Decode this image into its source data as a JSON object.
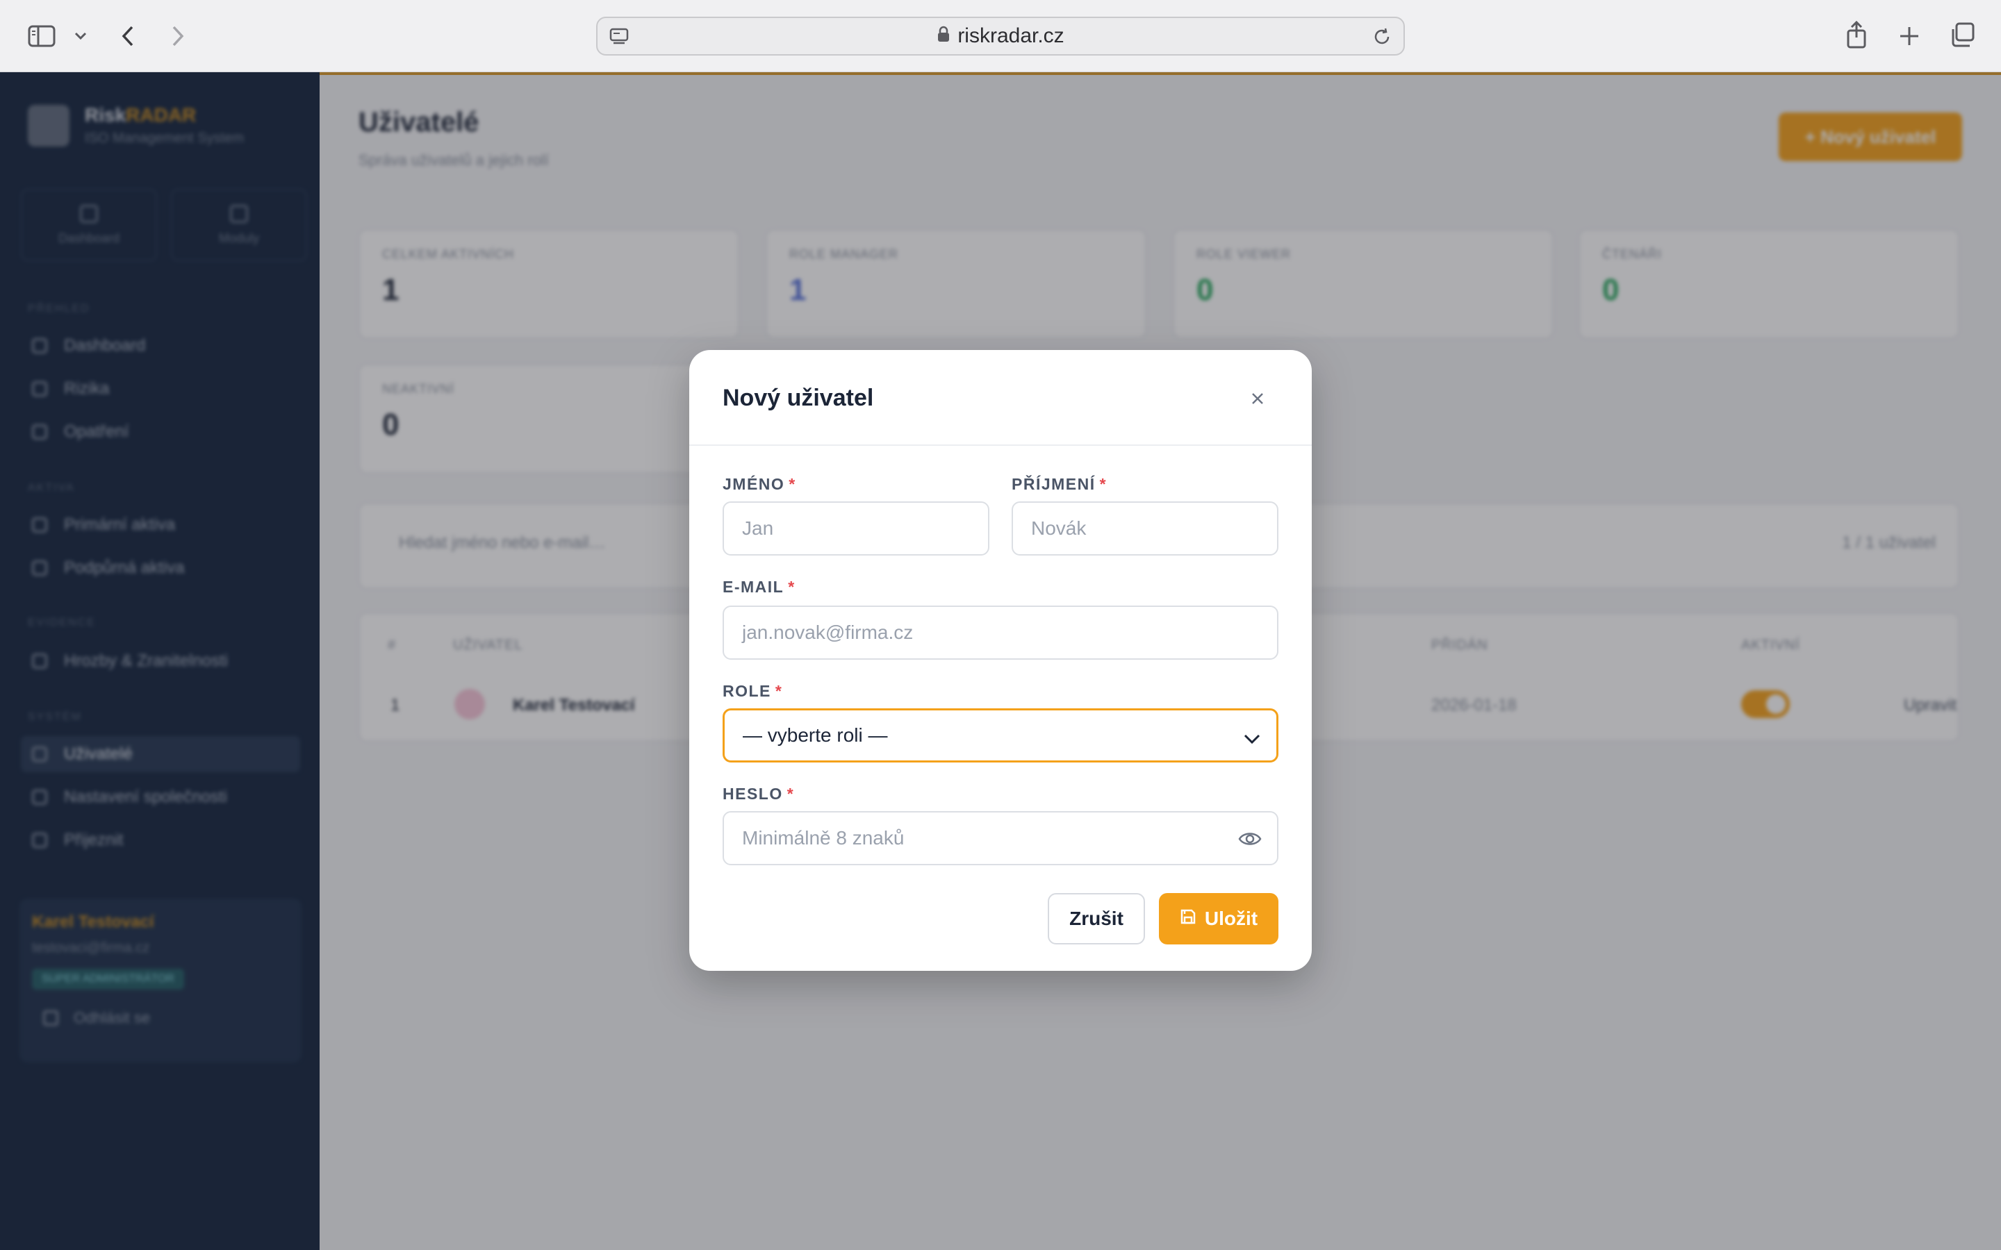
{
  "browser": {
    "url": "riskradar.cz"
  },
  "sidebar": {
    "brand_prefix": "Risk",
    "brand_suffix": "RADAR",
    "brand_sub": "ISO Management System",
    "tiles": [
      "Dashboard",
      "Moduly"
    ],
    "sections": [
      "PŘEHLED",
      "AKTIVA",
      "EVIDENCE",
      "SYSTÉM"
    ],
    "items": [
      {
        "label": "Dashboard"
      },
      {
        "label": "Rizika"
      },
      {
        "label": "Opatření"
      },
      {
        "label": "Primární aktiva"
      },
      {
        "label": "Podpůrná aktiva"
      },
      {
        "label": "Hrozby & Zranitelnosti"
      },
      {
        "label": "Uživatelé"
      },
      {
        "label": "Nastavení společnosti"
      },
      {
        "label": "Přijeznit"
      }
    ],
    "user_name": "Karel Testovací",
    "user_email": "testovaci@firma.cz",
    "user_badge": "SUPER ADMINISTRÁTOR",
    "logout": "Odhlásit se"
  },
  "main": {
    "title": "Uživatelé",
    "subtitle": "Správa uživatelů a jejich rolí",
    "new_button": "+ Nový uživatel",
    "stats": [
      {
        "label": "CELKEM AKTIVNÍCH",
        "value": "1",
        "color": "#1c2537"
      },
      {
        "label": "ROLE MANAGER",
        "value": "1",
        "color": "#4f6bd8"
      },
      {
        "label": "ROLE VIEWER",
        "value": "0",
        "color": "#22a55a"
      },
      {
        "label": "ČTENÁŘI",
        "value": "0",
        "color": "#22a55a"
      },
      {
        "label": "NEAKTIVNÍ",
        "value": "0",
        "color": "#1c2537"
      }
    ],
    "search_placeholder": "Hledat jméno nebo e-mail…",
    "user_count": "1 / 1 uživatel",
    "table": {
      "headers": [
        "#",
        "UŽIVATEL",
        "PŘIDÁN",
        "AKTIVNÍ"
      ],
      "row": {
        "index": "1",
        "name": "Karel Testovací",
        "date": "2026-01-18",
        "action": "Upravit"
      }
    }
  },
  "modal": {
    "title": "Nový uživatel",
    "first_name": {
      "label": "JMÉNO",
      "placeholder": "Jan"
    },
    "last_name": {
      "label": "PŘÍJMENÍ",
      "placeholder": "Novák"
    },
    "email": {
      "label": "E-MAIL",
      "placeholder": "jan.novak@firma.cz"
    },
    "role": {
      "label": "ROLE",
      "value": "— vyberte roli —"
    },
    "password": {
      "label": "HESLO",
      "placeholder": "Minimálně 8 znaků"
    },
    "required_mark": "*",
    "cancel": "Zrušit",
    "save": "Uložit"
  },
  "colors": {
    "accent": "#f4a11a",
    "sidebar": "#12233d",
    "required": "#e5484d"
  },
  "icons": [
    "sidebar-toggle-icon",
    "chevron-down-icon",
    "back-icon",
    "forward-icon",
    "site-icon",
    "lock-icon",
    "reload-icon",
    "share-icon",
    "plus-icon",
    "tabs-icon",
    "close-icon",
    "eye-icon",
    "save-icon"
  ]
}
